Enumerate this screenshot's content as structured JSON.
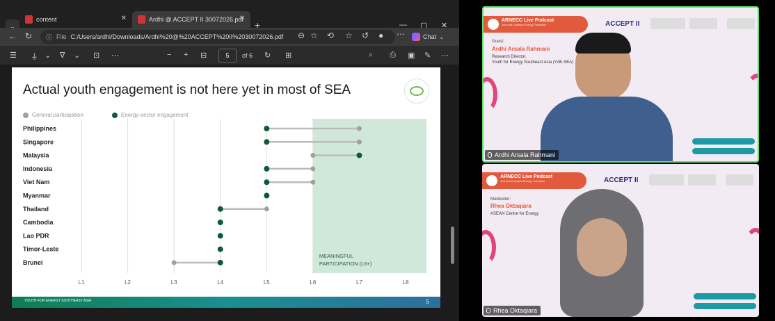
{
  "browser": {
    "tabs": [
      {
        "label": "content"
      },
      {
        "label": "Ardhi @ ACCEPT II 30072026.pdf"
      }
    ],
    "address": {
      "prefix": "File",
      "url": "C:/Users/ardhi/Downloads/Ardhi%20@%20ACCEPT%20II%2030072026.pdf"
    },
    "chat_label": "Chat",
    "pdf_toolbar": {
      "page_current": "5",
      "page_total": "of 6"
    }
  },
  "slide": {
    "title": "Actual youth engagement is not here yet in most of SEA",
    "logo_text": "YOUTH FOR ENERGY SOUTHEAST ASIA",
    "footer_logo": "YOUTH FOR ENERGY SOUTHEAST ASIA",
    "page_number": "5"
  },
  "chart_data": {
    "type": "dumbbell",
    "categories": [
      "Philippines",
      "Singapore",
      "Malaysia",
      "Indonesia",
      "Viet Nam",
      "Myanmar",
      "Thailand",
      "Cambodia",
      "Lao PDR",
      "Timor-Leste",
      "Brunei"
    ],
    "x_ticks": [
      "L1",
      "L2",
      "L3",
      "L4",
      "L5",
      "L6",
      "L7",
      "L8"
    ],
    "series": [
      {
        "name": "General participation",
        "color": "#a0a0a0",
        "values": [
          7,
          7,
          6,
          6,
          6,
          5,
          5,
          4,
          4,
          4,
          3
        ]
      },
      {
        "name": "Energy-sector engagement",
        "color": "#0d5a36",
        "values": [
          5,
          5,
          7,
          5,
          5,
          5,
          4,
          4,
          4,
          4,
          4
        ]
      }
    ],
    "highlight": {
      "from": 6,
      "to": 8.45,
      "label_line1": "MEANINGFUL",
      "label_line2": "PARTICIPATION (L6+)",
      "color": "#cfe8d9"
    },
    "xlim": [
      1,
      8.45
    ]
  },
  "meeting": {
    "tiles": [
      {
        "banner_title": "ARNECC Live Podcast",
        "banner_sub": "Just and Inclusive Energy Transition",
        "accept_label": "ACCEPT II",
        "role": "Guest:",
        "person": "Ardhi Arsala Rahmani",
        "desc1": "Research Director,",
        "desc2": "Youth for Energy Southeast Asia (Y4E-SEA)",
        "caption": "Ardhi Arsala Rahmani"
      },
      {
        "banner_title": "ARNECC Live Podcast",
        "banner_sub": "Just and Inclusive Energy Transition",
        "accept_label": "ACCEPT II",
        "role": "Moderator:",
        "person": "Rhea Oktaqiara",
        "desc1": "ASEAN Centre for Energy",
        "desc2": "",
        "caption": "Rhea Oktaqiara"
      }
    ]
  }
}
